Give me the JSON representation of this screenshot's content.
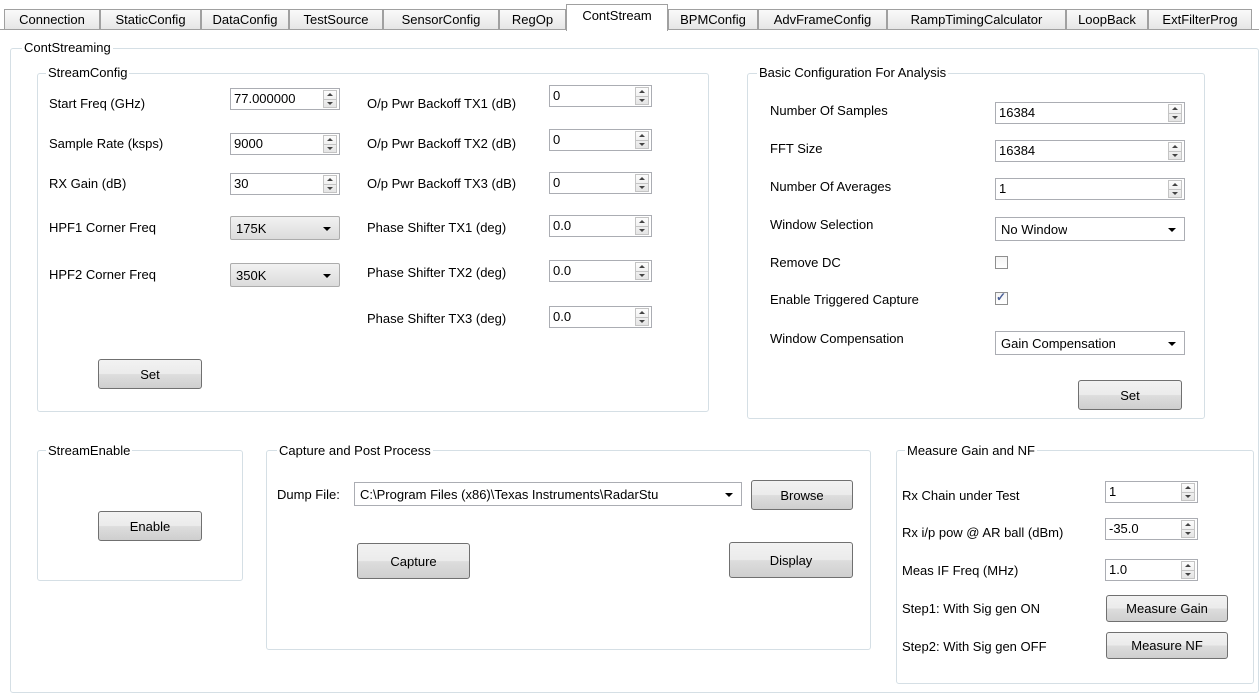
{
  "tabs": [
    {
      "label": "Connection"
    },
    {
      "label": "StaticConfig"
    },
    {
      "label": "DataConfig"
    },
    {
      "label": "TestSource"
    },
    {
      "label": "SensorConfig"
    },
    {
      "label": "RegOp"
    },
    {
      "label": "ContStream",
      "active": true
    },
    {
      "label": "BPMConfig"
    },
    {
      "label": "AdvFrameConfig"
    },
    {
      "label": "RampTimingCalculator"
    },
    {
      "label": "LoopBack"
    },
    {
      "label": "ExtFilterProg"
    }
  ],
  "outer_title": "ContStreaming",
  "stream_config": {
    "title": "StreamConfig",
    "start_freq_label": "Start Freq (GHz)",
    "start_freq_value": "77.000000",
    "sample_rate_label": "Sample Rate (ksps)",
    "sample_rate_value": "9000",
    "rx_gain_label": "RX Gain (dB)",
    "rx_gain_value": "30",
    "hpf1_label": "HPF1 Corner Freq",
    "hpf1_value": "175K",
    "hpf2_label": "HPF2 Corner Freq",
    "hpf2_value": "350K",
    "tx1_backoff_label": "O/p Pwr Backoff TX1 (dB)",
    "tx1_backoff_value": "0",
    "tx2_backoff_label": "O/p Pwr Backoff TX2 (dB)",
    "tx2_backoff_value": "0",
    "tx3_backoff_label": "O/p Pwr Backoff TX3 (dB)",
    "tx3_backoff_value": "0",
    "ps_tx1_label": "Phase Shifter TX1 (deg)",
    "ps_tx1_value": "0.0",
    "ps_tx2_label": "Phase Shifter TX2 (deg)",
    "ps_tx2_value": "0.0",
    "ps_tx3_label": "Phase Shifter TX3 (deg)",
    "ps_tx3_value": "0.0",
    "set_label": "Set"
  },
  "basic_config": {
    "title": "Basic Configuration For Analysis",
    "num_samples_label": "Number Of Samples",
    "num_samples_value": "16384",
    "fft_size_label": "FFT Size",
    "fft_size_value": "16384",
    "num_averages_label": "Number Of Averages",
    "num_averages_value": "1",
    "window_sel_label": "Window Selection",
    "window_sel_value": "No Window",
    "remove_dc_label": "Remove DC",
    "remove_dc_checked": false,
    "triggered_capture_label": "Enable Triggered Capture",
    "triggered_capture_checked": true,
    "window_comp_label": "Window Compensation",
    "window_comp_value": "Gain Compensation",
    "set_label": "Set"
  },
  "stream_enable": {
    "title": "StreamEnable",
    "enable_label": "Enable"
  },
  "capture": {
    "title": "Capture and Post Process",
    "dump_file_label": "Dump File:",
    "dump_file_value": "C:\\Program Files (x86)\\Texas Instruments\\RadarStu",
    "browse_label": "Browse",
    "capture_label": "Capture",
    "display_label": "Display"
  },
  "measure": {
    "title": "Measure Gain and NF",
    "rx_chain_label": "Rx Chain under Test",
    "rx_chain_value": "1",
    "rx_pow_label": "Rx i/p pow @ AR ball (dBm)",
    "rx_pow_value": "-35.0",
    "meas_if_label": "Meas IF Freq (MHz)",
    "meas_if_value": "1.0",
    "step1_label": "Step1: With Sig gen ON",
    "measure_gain_label": "Measure Gain",
    "step2_label": "Step2: With Sig gen OFF",
    "measure_nf_label": "Measure NF"
  }
}
